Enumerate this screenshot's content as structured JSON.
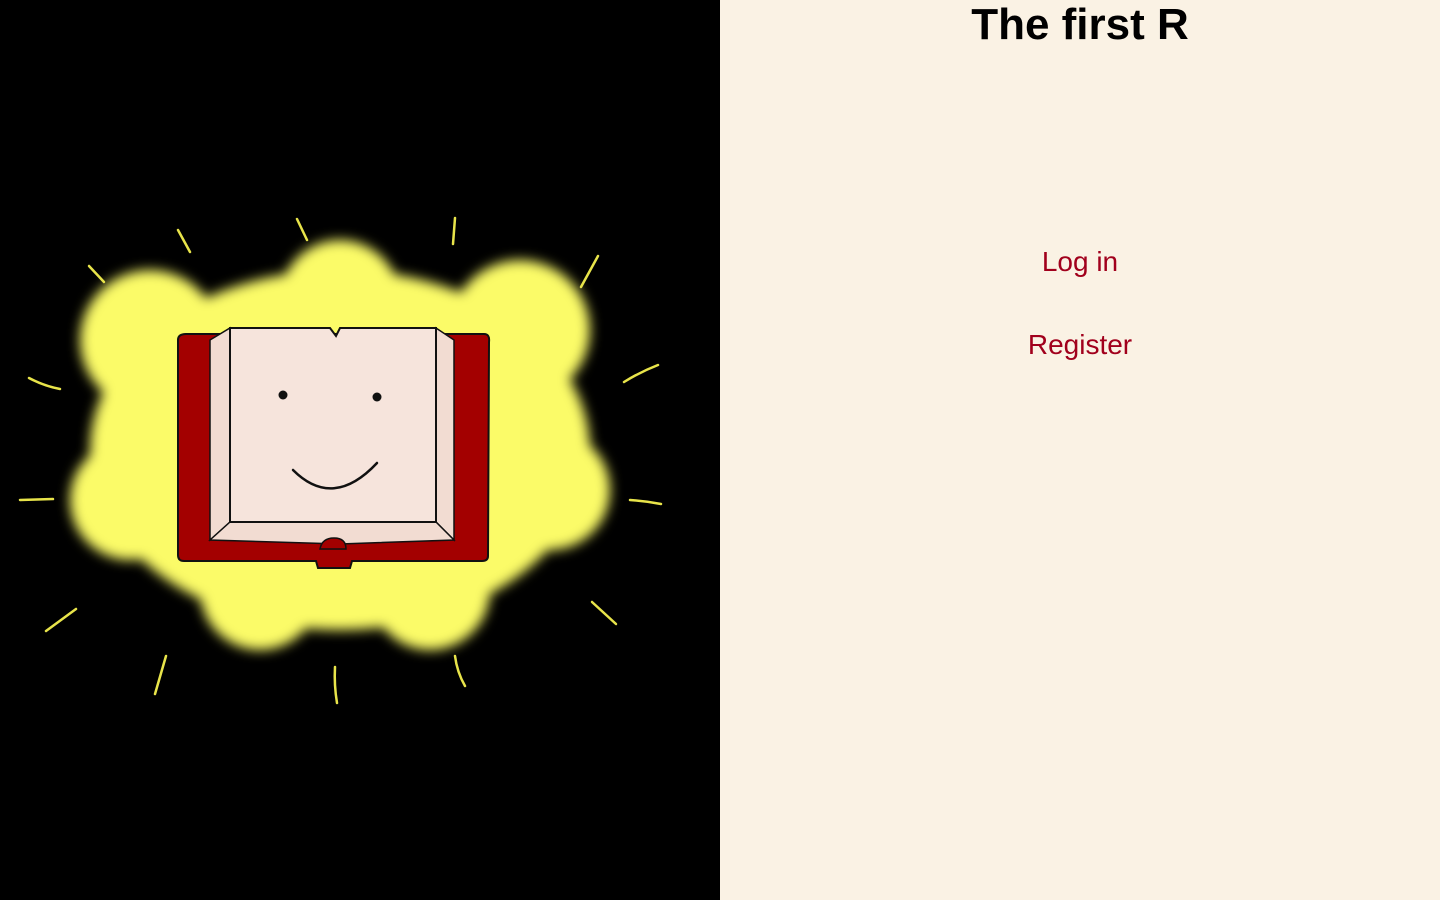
{
  "page": {
    "title": "The first R"
  },
  "nav": {
    "login_label": "Log in",
    "register_label": "Register"
  },
  "hero": {
    "icon": "smiling-open-book-icon"
  },
  "colors": {
    "left_background": "#000000",
    "right_background": "#faf2e4",
    "link": "#a1001c",
    "glow": "#fbfb68",
    "book_cover": "#a30000",
    "book_pages": "#f6e4dc"
  }
}
